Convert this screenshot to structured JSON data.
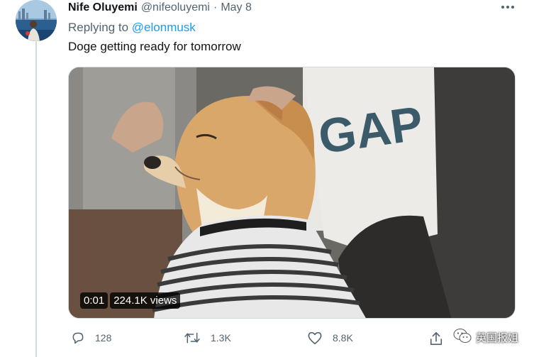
{
  "tweet": {
    "display_name": "Nife Oluyemi",
    "handle": "@nifeoluyemi",
    "separator": "·",
    "date": "May 8",
    "more_icon": "more-dots-icon",
    "replying_prefix": "Replying to",
    "replying_mention": "@elonmusk",
    "text": "Doge getting ready for tomorrow"
  },
  "media": {
    "time": "0:01",
    "views": "224.1K views",
    "shirt_text": "GAP"
  },
  "actions": {
    "reply_count": "128",
    "retweet_count": "1.3K",
    "like_count": "8.8K",
    "reply_icon": "reply-bubble-icon",
    "retweet_icon": "retweet-icon",
    "like_icon": "heart-icon",
    "share_icon": "share-icon"
  },
  "watermark": {
    "text": "英国报姐",
    "icon": "wechat-icon"
  },
  "colors": {
    "text_primary": "#0f1419",
    "text_secondary": "#536471",
    "link": "#1d9bf0",
    "border": "#cfd9de"
  }
}
